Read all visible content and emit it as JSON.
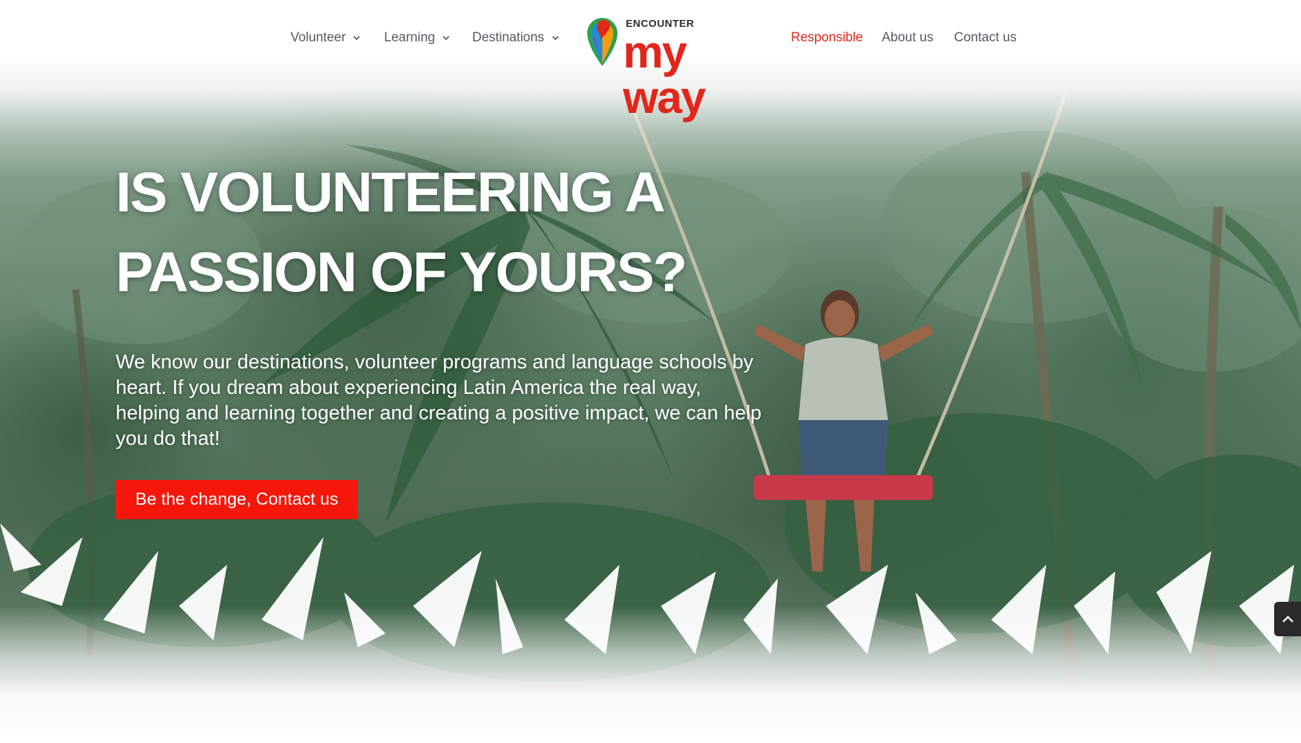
{
  "nav": {
    "items": [
      {
        "label": "Volunteer",
        "dropdown": true
      },
      {
        "label": "Learning",
        "dropdown": true
      },
      {
        "label": "Destinations",
        "dropdown": true
      },
      {
        "label": "Responsible",
        "dropdown": false,
        "active": true
      },
      {
        "label": "About us",
        "dropdown": false
      },
      {
        "label": "Contact us",
        "dropdown": false
      }
    ],
    "icons": {
      "dropdown": "chevron-down-icon"
    }
  },
  "logo": {
    "top_text": "ENCOUNTER",
    "main_text": "my way",
    "icon": "colorful-pin-icon"
  },
  "hero": {
    "headline": "IS VOLUNTEERING A PASSION OF YOURS?",
    "intro": "We know our destinations, volunteer programs and language schools by heart. If you dream about experiencing Latin America the real way, helping and learning together and creating a positive impact, we can help you do that!",
    "cta_label": "Be the change, Contact us"
  },
  "scroll_top": {
    "icon": "chevron-up-icon"
  },
  "colors": {
    "accent": "#e3261b",
    "cta_background": "#f5170b",
    "nav_text": "#555a5d",
    "headline": "#ffffff"
  }
}
